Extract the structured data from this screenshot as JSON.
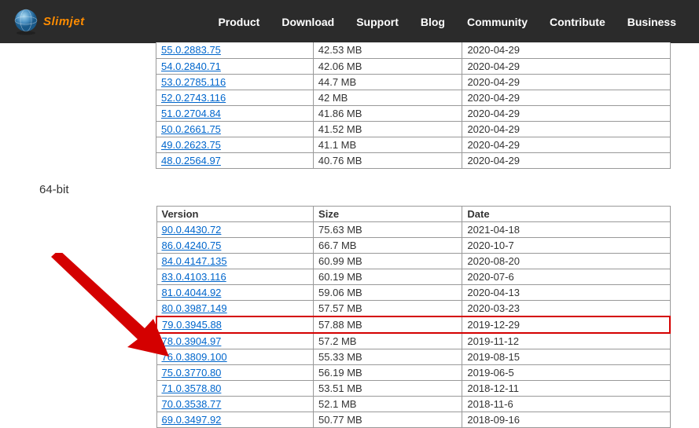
{
  "header": {
    "brand": "Slimjet",
    "nav": [
      "Product",
      "Download",
      "Support",
      "Blog",
      "Community",
      "Contribute",
      "Business"
    ]
  },
  "table1": {
    "rows": [
      {
        "version": "55.0.2883.75",
        "size": "42.53 MB",
        "date": "2020-04-29"
      },
      {
        "version": "54.0.2840.71",
        "size": "42.06 MB",
        "date": "2020-04-29"
      },
      {
        "version": "53.0.2785.116",
        "size": "44.7 MB",
        "date": "2020-04-29"
      },
      {
        "version": "52.0.2743.116",
        "size": "42 MB",
        "date": "2020-04-29"
      },
      {
        "version": "51.0.2704.84",
        "size": "41.86 MB",
        "date": "2020-04-29"
      },
      {
        "version": "50.0.2661.75",
        "size": "41.52 MB",
        "date": "2020-04-29"
      },
      {
        "version": "49.0.2623.75",
        "size": "41.1 MB",
        "date": "2020-04-29"
      },
      {
        "version": "48.0.2564.97",
        "size": "40.76 MB",
        "date": "2020-04-29"
      }
    ]
  },
  "section_title": "64-bit",
  "table2": {
    "headers": {
      "version": "Version",
      "size": "Size",
      "date": "Date"
    },
    "rows": [
      {
        "version": "90.0.4430.72",
        "size": "75.63 MB",
        "date": "2021-04-18",
        "highlight": false
      },
      {
        "version": "86.0.4240.75",
        "size": "66.7 MB",
        "date": "2020-10-7",
        "highlight": false
      },
      {
        "version": "84.0.4147.135",
        "size": "60.99 MB",
        "date": "2020-08-20",
        "highlight": false
      },
      {
        "version": "83.0.4103.116",
        "size": "60.19 MB",
        "date": "2020-07-6",
        "highlight": false
      },
      {
        "version": "81.0.4044.92",
        "size": "59.06 MB",
        "date": "2020-04-13",
        "highlight": false
      },
      {
        "version": "80.0.3987.149",
        "size": "57.57 MB",
        "date": "2020-03-23",
        "highlight": false
      },
      {
        "version": "79.0.3945.88",
        "size": "57.88 MB",
        "date": "2019-12-29",
        "highlight": true
      },
      {
        "version": "78.0.3904.97",
        "size": "57.2 MB",
        "date": "2019-11-12",
        "highlight": false
      },
      {
        "version": "76.0.3809.100",
        "size": "55.33 MB",
        "date": "2019-08-15",
        "highlight": false
      },
      {
        "version": "75.0.3770.80",
        "size": "56.19 MB",
        "date": "2019-06-5",
        "highlight": false
      },
      {
        "version": "71.0.3578.80",
        "size": "53.51 MB",
        "date": "2018-12-11",
        "highlight": false
      },
      {
        "version": "70.0.3538.77",
        "size": "52.1 MB",
        "date": "2018-11-6",
        "highlight": false
      },
      {
        "version": "69.0.3497.92",
        "size": "50.77 MB",
        "date": "2018-09-16",
        "highlight": false
      }
    ]
  }
}
